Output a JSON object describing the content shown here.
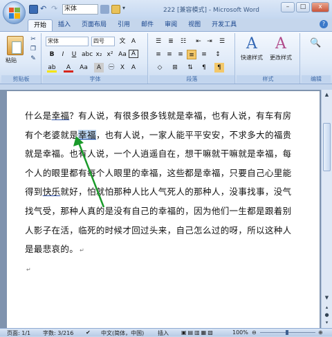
{
  "window": {
    "title": "222 [兼容模式] - Microsoft Word",
    "buttons": [
      "–",
      "□",
      "x"
    ],
    "help": "?"
  },
  "quick_access": {
    "font_value": "宋体"
  },
  "tabs": [
    "开始",
    "插入",
    "页面布局",
    "引用",
    "邮件",
    "审阅",
    "视图",
    "开发工具"
  ],
  "ribbon": {
    "clipboard": {
      "paste_label": "粘贴",
      "group_label": "剪贴板"
    },
    "font": {
      "font_name": "宋体",
      "font_size": "四号",
      "group_label": "字体"
    },
    "paragraph": {
      "group_label": "段落"
    },
    "styles": {
      "quick_styles": "快速样式",
      "change_styles": "更改样式",
      "group_label": "样式"
    },
    "editing": {
      "group_label": "编辑"
    }
  },
  "document": {
    "lines": [
      [
        "什么是",
        "幸福",
        "？有人说，有很多很多钱就是幸福，也有人说，有车有房"
      ],
      [
        "有个老婆就是",
        "幸福",
        "，也有人说，一家人能平平安安，不求多大的福贵"
      ],
      [
        "就是幸福。也有人说，一个人逍遥自在，想干嘛就干嘛就是幸福，每"
      ],
      [
        "个人的眼里都有每个人眼里的幸福，这些都是幸福，只要自己心里能"
      ],
      [
        "得到",
        "快乐",
        "就好，怕就怕那种人比人气死人的那种人，没事找事，没气"
      ],
      [
        "找气受，那种人真的是没有自己的幸福的，因为他们一生都是跟着别"
      ],
      [
        "人影子在活，临死的时候才回过头来，自己怎么过的呀，所以这种人"
      ],
      [
        "是最悲哀的。"
      ]
    ]
  },
  "statusbar": {
    "page": "页面: 1/1",
    "words": "字数: 3/216",
    "language": "中文(简体，中国)",
    "mode": "插入",
    "zoom": "100%"
  },
  "colors": {
    "highlight": "#b9d3ef",
    "arrow": "#1a9a2a"
  }
}
